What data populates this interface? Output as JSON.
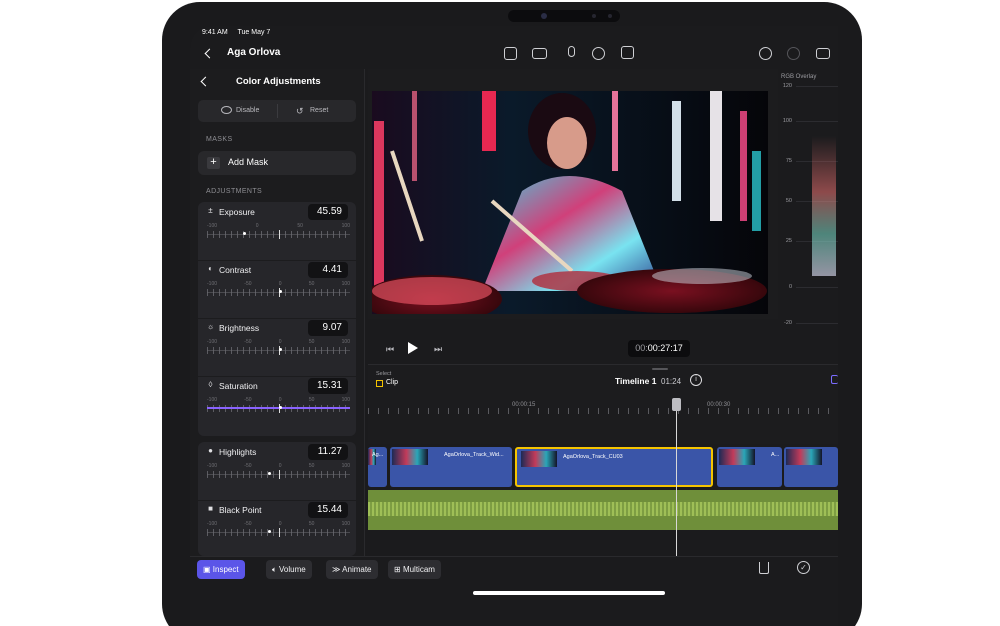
{
  "status": {
    "time": "9:41 AM",
    "date": "Tue May 7"
  },
  "header": {
    "title": "Aga Orlova"
  },
  "panel": {
    "title": "Color Adjustments",
    "disable_label": "Disable",
    "reset_label": "Reset",
    "masks_label": "MASKS",
    "add_mask_label": "Add Mask",
    "adjustments_label": "ADJUSTMENTS"
  },
  "adjustments": [
    {
      "label": "Exposure",
      "icon": "±",
      "value": "45.59",
      "ticks": [
        "-100",
        "0",
        "50",
        "100"
      ],
      "level": 0.25
    },
    {
      "label": "Contrast",
      "icon": "◐",
      "value": "4.41",
      "ticks": [
        "-100",
        "-50",
        "0",
        "50",
        "100"
      ],
      "level": 0.5
    },
    {
      "label": "Brightness",
      "icon": "☼",
      "value": "9.07",
      "ticks": [
        "-100",
        "-50",
        "0",
        "50",
        "100"
      ],
      "level": 0.5
    },
    {
      "label": "Saturation",
      "icon": "◊",
      "value": "15.31",
      "ticks": [
        "-100",
        "-50",
        "0",
        "50",
        "100"
      ],
      "level": 0.5
    },
    {
      "label": "Highlights",
      "icon": "●",
      "value": "11.27",
      "ticks": [
        "-100",
        "-50",
        "0",
        "50",
        "100"
      ],
      "level": 0.43
    },
    {
      "label": "Black Point",
      "icon": "■",
      "value": "15.44",
      "ticks": [
        "-100",
        "-50",
        "0",
        "50",
        "100"
      ],
      "level": 0.43
    }
  ],
  "scope": {
    "title": "RGB Overlay",
    "labels": [
      "120",
      "100",
      "75",
      "50",
      "25",
      "0",
      "-20"
    ]
  },
  "viewer": {
    "timecode_dim": "00:",
    "timecode_main": "00:27:17"
  },
  "timeline": {
    "select_label": "Select",
    "clip_label": "Clip",
    "title": "Timeline 1",
    "duration": "01:24",
    "tc1": "00:00:15",
    "tc2": "00:00:30",
    "clips": [
      "Ag...",
      "AgaOrlova_Track_Wid...",
      "AgaOrlova_Track_CU03",
      "A...",
      ""
    ]
  },
  "toolbar": {
    "inspect": "Inspect",
    "volume": "Volume",
    "animate": "Animate",
    "multicam": "Multicam"
  },
  "colors": {
    "accent": "#5b55e8",
    "video_track": "#3a55a8",
    "audio_track": "#6f8f3a",
    "selected_clip": "#f5c400"
  }
}
